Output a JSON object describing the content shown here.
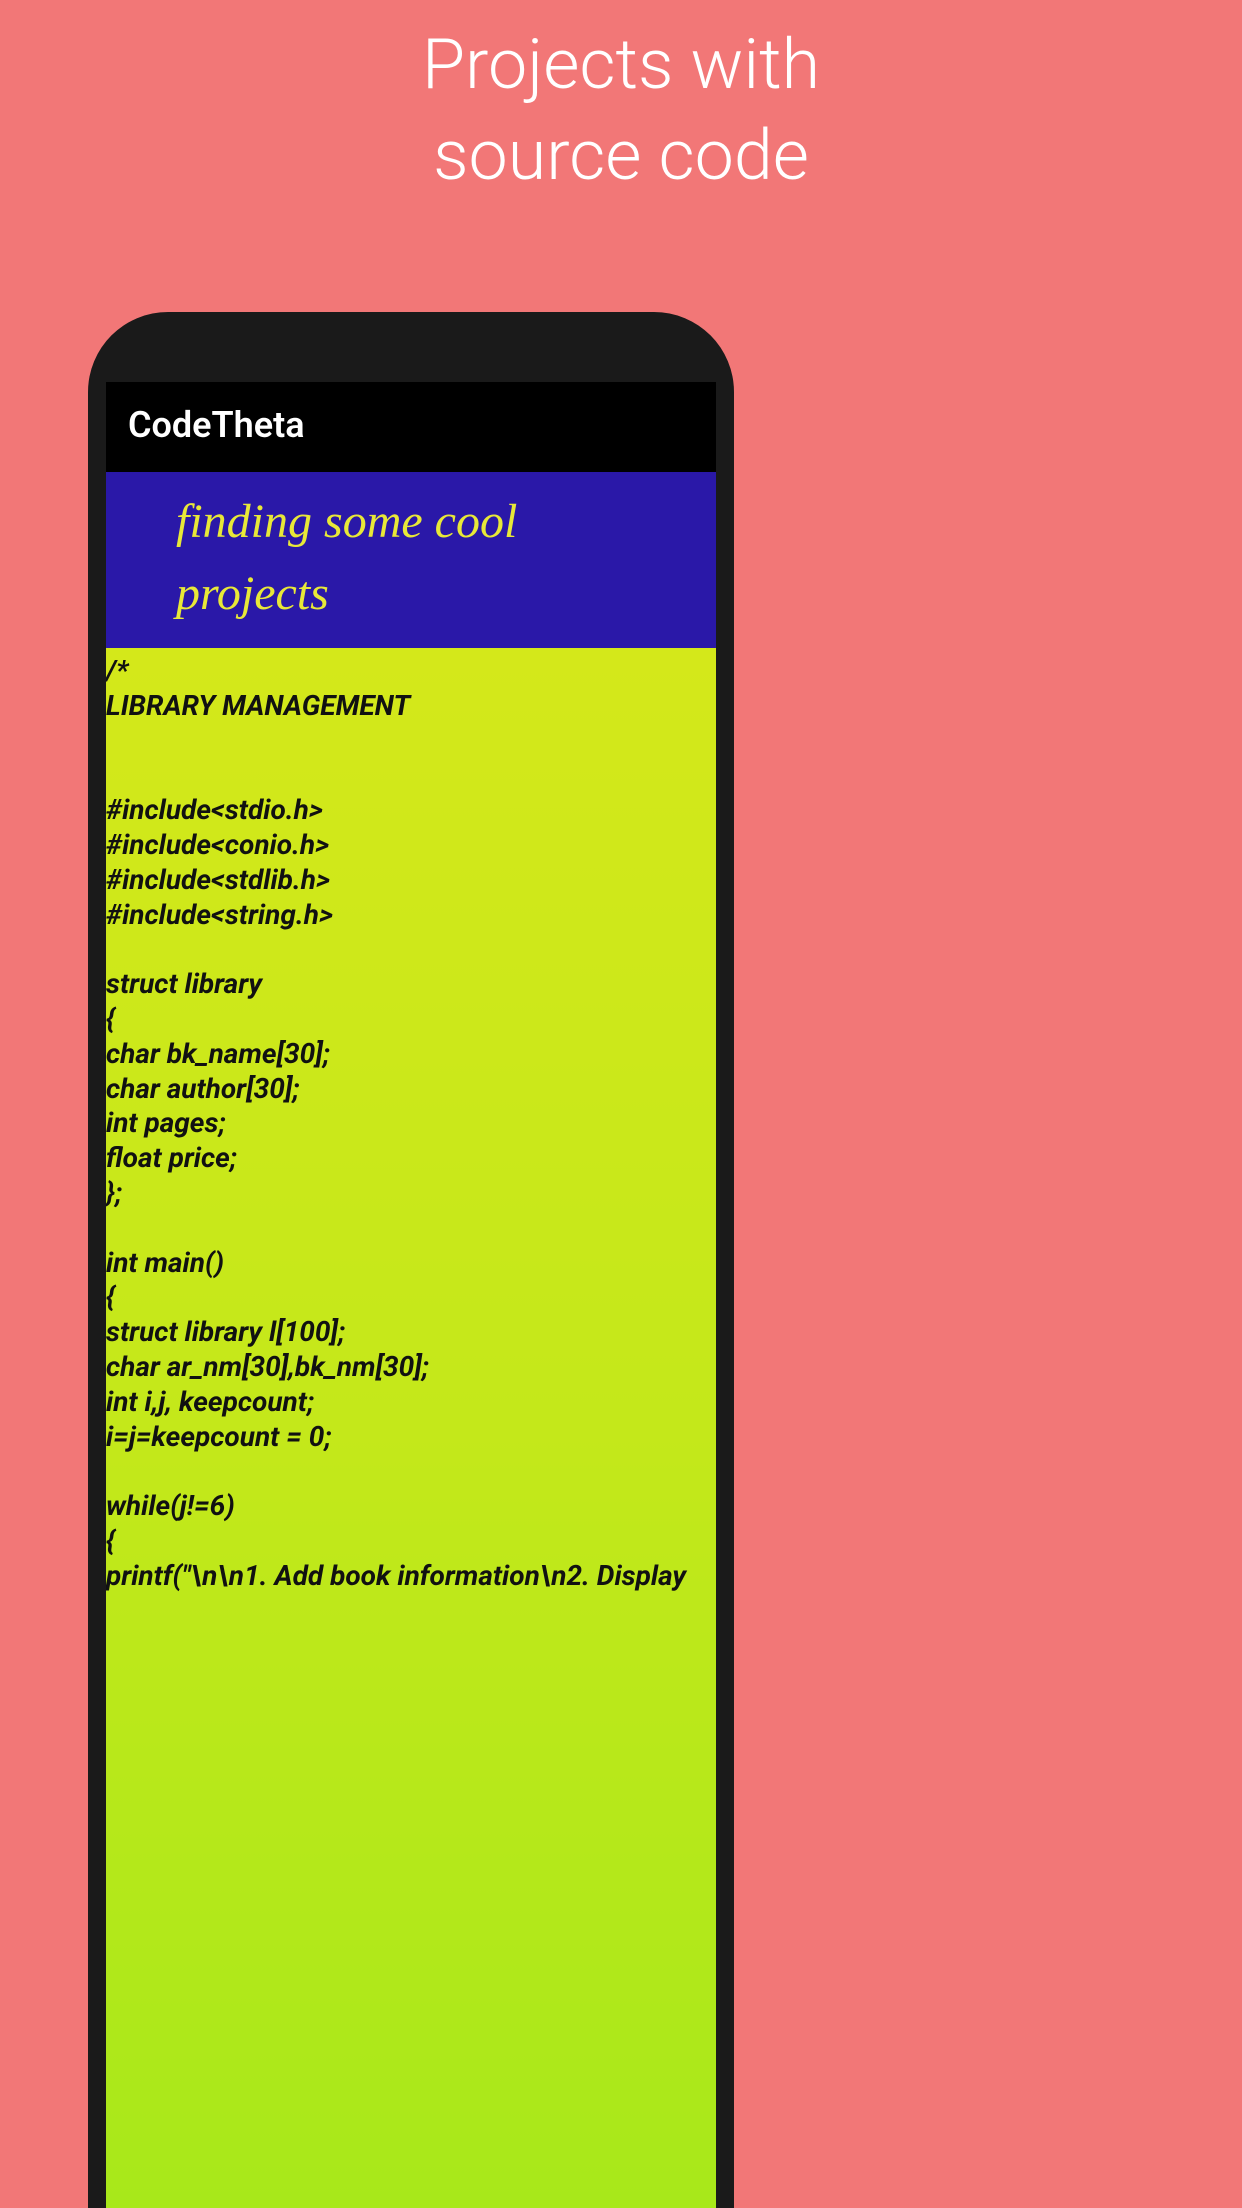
{
  "promo": {
    "line1": "Projects with",
    "line2": "source code"
  },
  "app": {
    "header_title": "CodeTheta",
    "banner_text": "finding some cool projects"
  },
  "code": {
    "lines": [
      "/*",
      "LIBRARY MANAGEMENT",
      "",
      "",
      "#include<stdio.h>",
      "#include<conio.h>",
      "#include<stdlib.h>",
      "#include<string.h>",
      "",
      "struct library",
      "{",
      "char bk_name[30];",
      "char author[30];",
      "int pages;",
      "float price;",
      "};",
      "",
      "int main()",
      "{",
      "struct library l[100];",
      "char ar_nm[30],bk_nm[30];",
      "int i,j, keepcount;",
      "i=j=keepcount = 0;",
      "",
      "while(j!=6)",
      "{",
      "printf(\"\\n\\n1. Add book information\\n2. Display"
    ]
  }
}
